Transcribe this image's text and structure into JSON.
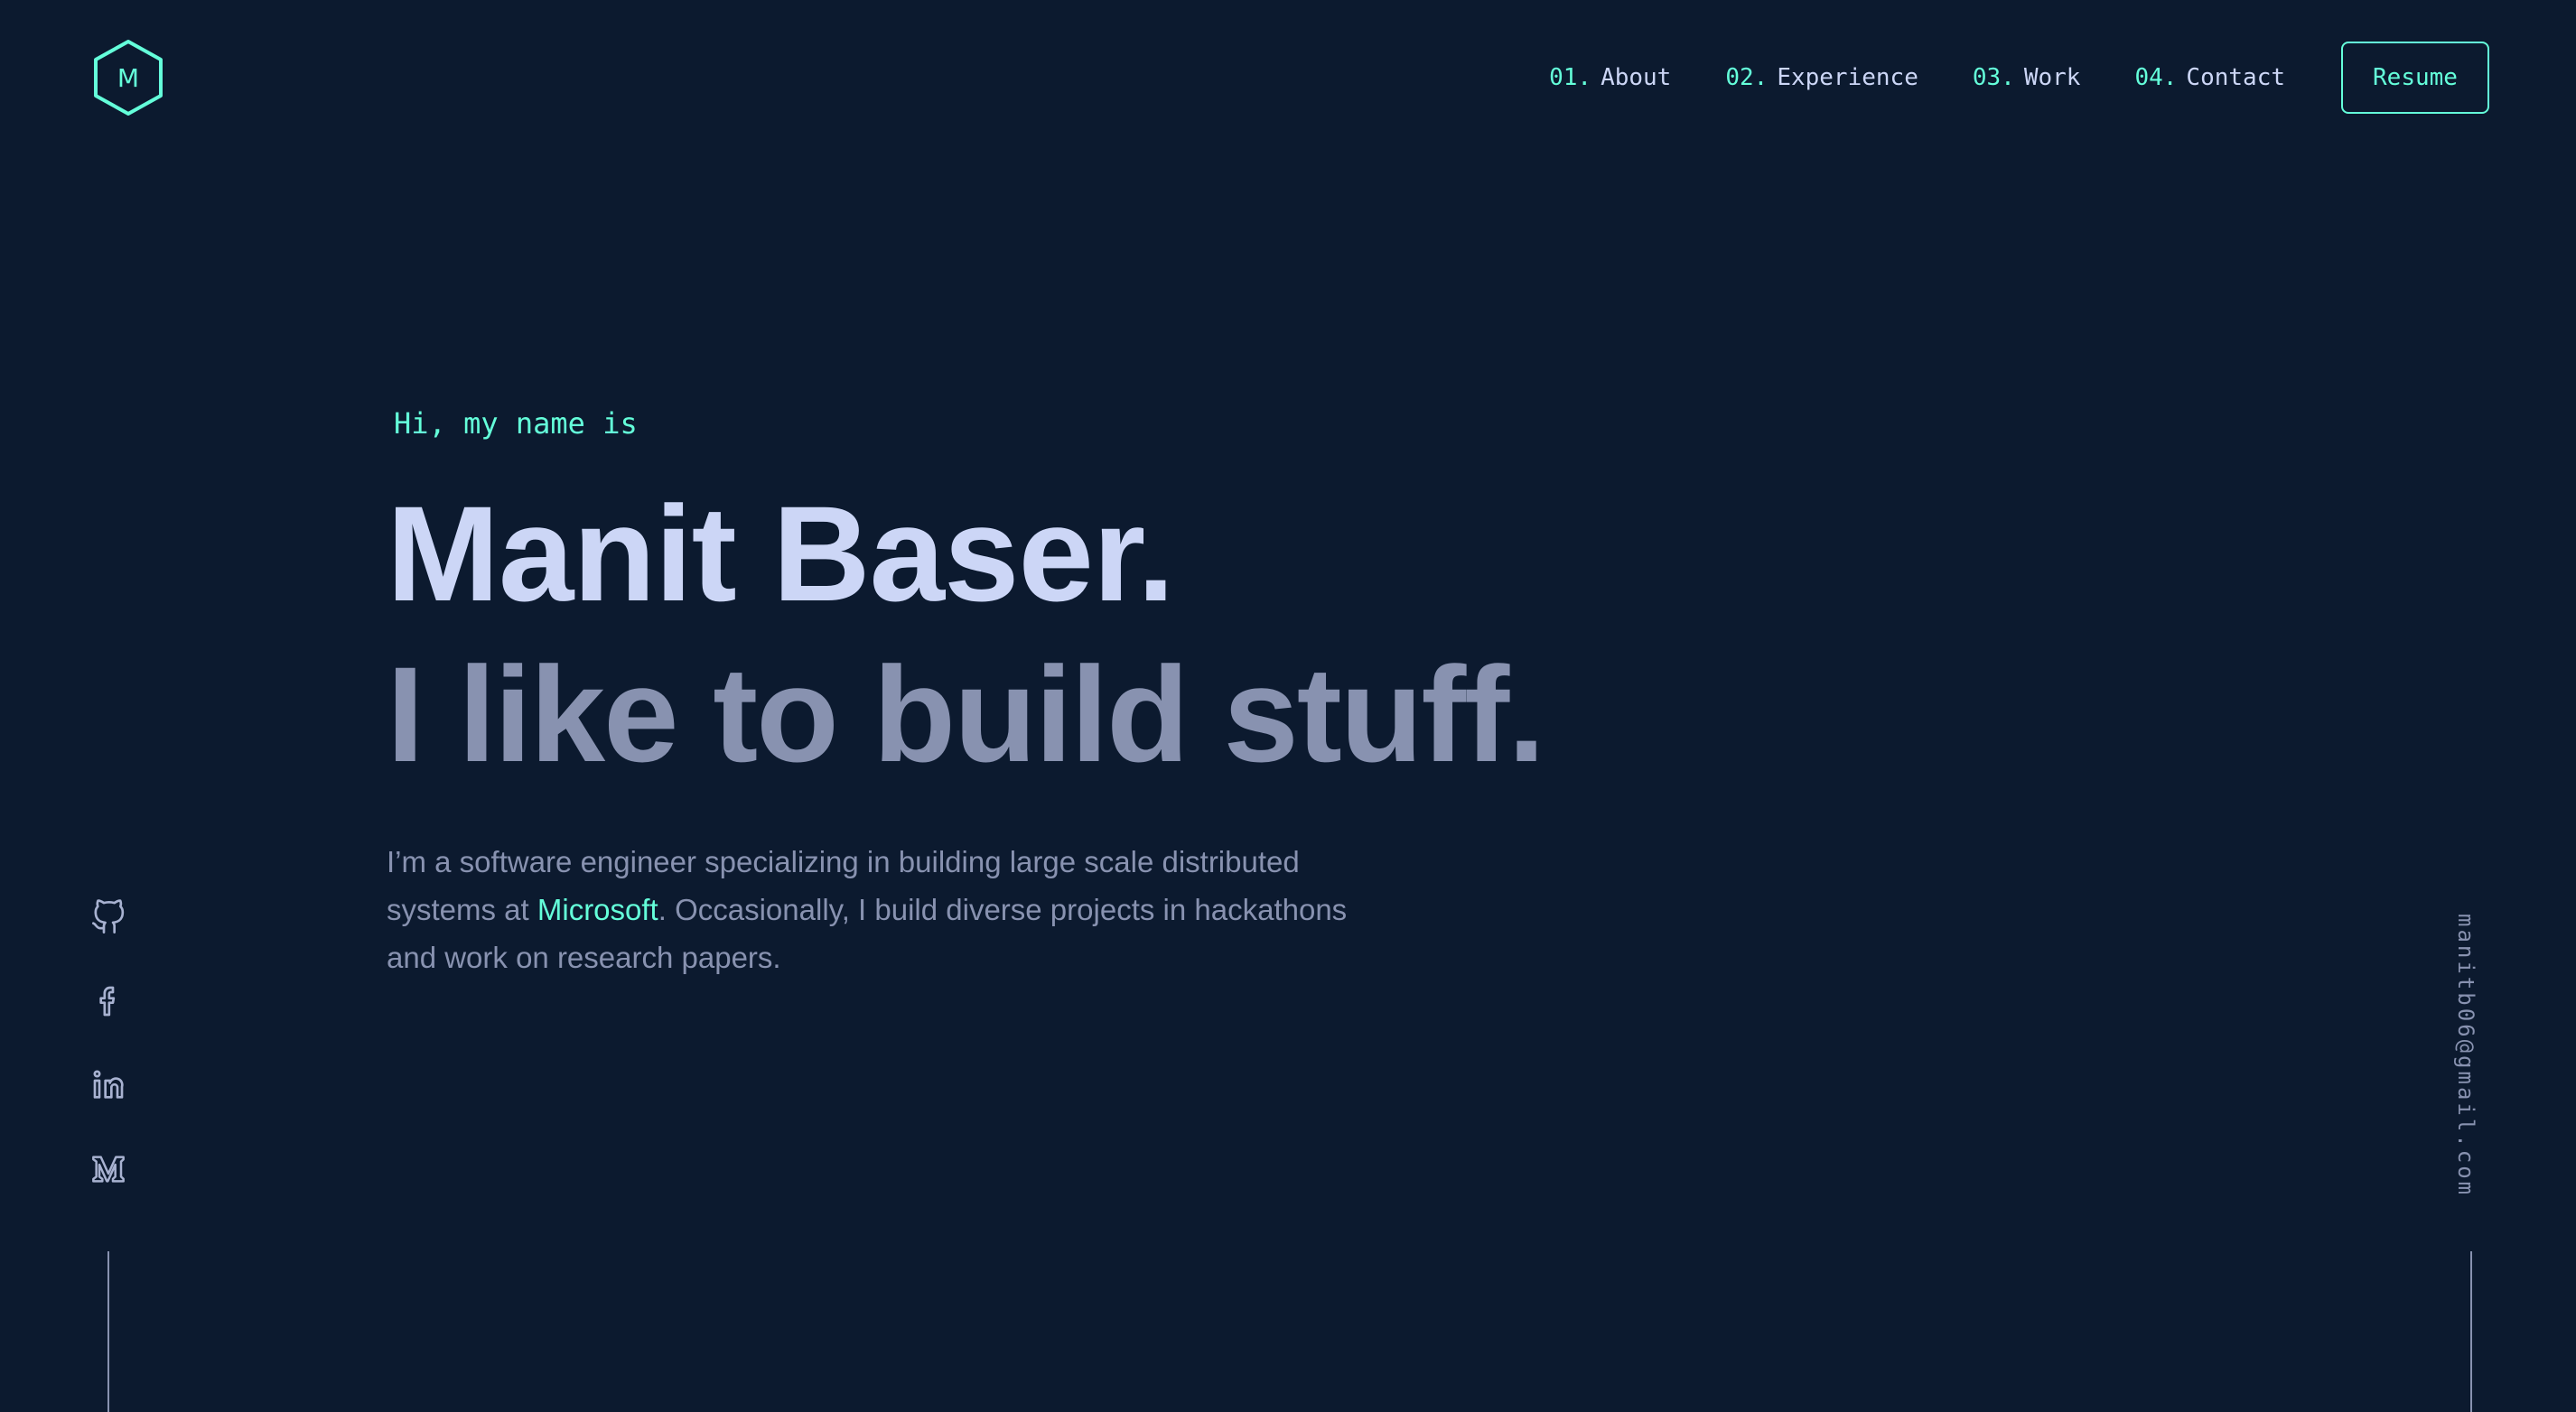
{
  "logo": {
    "letter": "M",
    "icon": "hexagon-logo-icon"
  },
  "nav": {
    "items": [
      {
        "num": "01.",
        "label": "About"
      },
      {
        "num": "02.",
        "label": "Experience"
      },
      {
        "num": "03.",
        "label": "Work"
      },
      {
        "num": "04.",
        "label": "Contact"
      }
    ],
    "resume_label": "Resume"
  },
  "hero": {
    "greeting": "Hi, my name is",
    "name": "Manit Baser.",
    "tagline": "I like to build stuff.",
    "intro_before": "I’m a software engineer specializing in building large scale distributed systems at ",
    "intro_highlight": "Microsoft",
    "intro_after": ". Occasionally, I build diverse projects in hackathons and work on research papers."
  },
  "socials": [
    {
      "icon": "github-icon"
    },
    {
      "icon": "facebook-icon"
    },
    {
      "icon": "linkedin-icon"
    },
    {
      "icon": "medium-icon"
    }
  ],
  "email": "manitb06@gmail.com",
  "colors": {
    "background": "#0c1a2f",
    "accent": "#64ffda",
    "heading": "#ccd6f6",
    "text": "#8892b0"
  }
}
